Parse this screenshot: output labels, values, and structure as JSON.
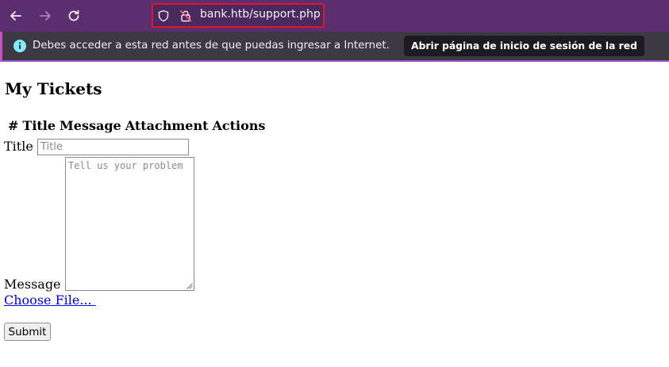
{
  "browser": {
    "url": "bank.htb/support.php",
    "icons": [
      "back-arrow-icon",
      "forward-arrow-icon",
      "reload-icon",
      "tracking-shield-icon",
      "insecure-lock-icon"
    ],
    "colors": {
      "toolbar": "#5b2f6f",
      "url_highlight": "#e0142a"
    }
  },
  "notification": {
    "icon": "info-icon",
    "message": "Debes acceder a esta red antes de que puedas ingresar a Internet.",
    "button_label": "Abrir página de inicio de sesión de la red"
  },
  "page": {
    "title": "My Tickets",
    "table_headers": [
      "#",
      "Title",
      "Message",
      "Attachment",
      "Actions"
    ],
    "form": {
      "title_label": "Title",
      "title_placeholder": "Title",
      "message_label": "Message",
      "message_placeholder": "Tell us your problem",
      "file_link": "Choose File... ",
      "submit_label": "Submit"
    }
  }
}
